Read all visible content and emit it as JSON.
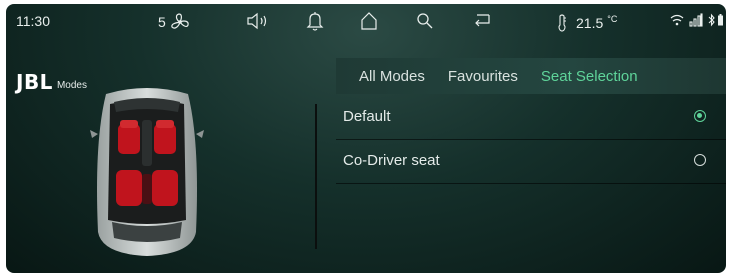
{
  "status": {
    "time": "11:30",
    "fan_level": "5",
    "temperature": "21.5",
    "temperature_unit": "°C",
    "icons": [
      "fan-icon",
      "volume-icon",
      "bell-icon",
      "home-icon",
      "search-icon",
      "back-icon",
      "thermometer-icon",
      "wifi-icon",
      "signal-icon",
      "bluetooth-icon",
      "battery-icon"
    ]
  },
  "brand": {
    "logo": "JBL",
    "label": "Modes"
  },
  "tabs": [
    {
      "label": "All Modes",
      "active": false
    },
    {
      "label": "Favourites",
      "active": false
    },
    {
      "label": "Seat Selection",
      "active": true
    }
  ],
  "options": [
    {
      "label": "Default",
      "selected": true
    },
    {
      "label": "Co-Driver seat",
      "selected": false
    }
  ],
  "colors": {
    "accent": "#5fd49a",
    "seat": "#c0141d",
    "background": "#15302b"
  }
}
